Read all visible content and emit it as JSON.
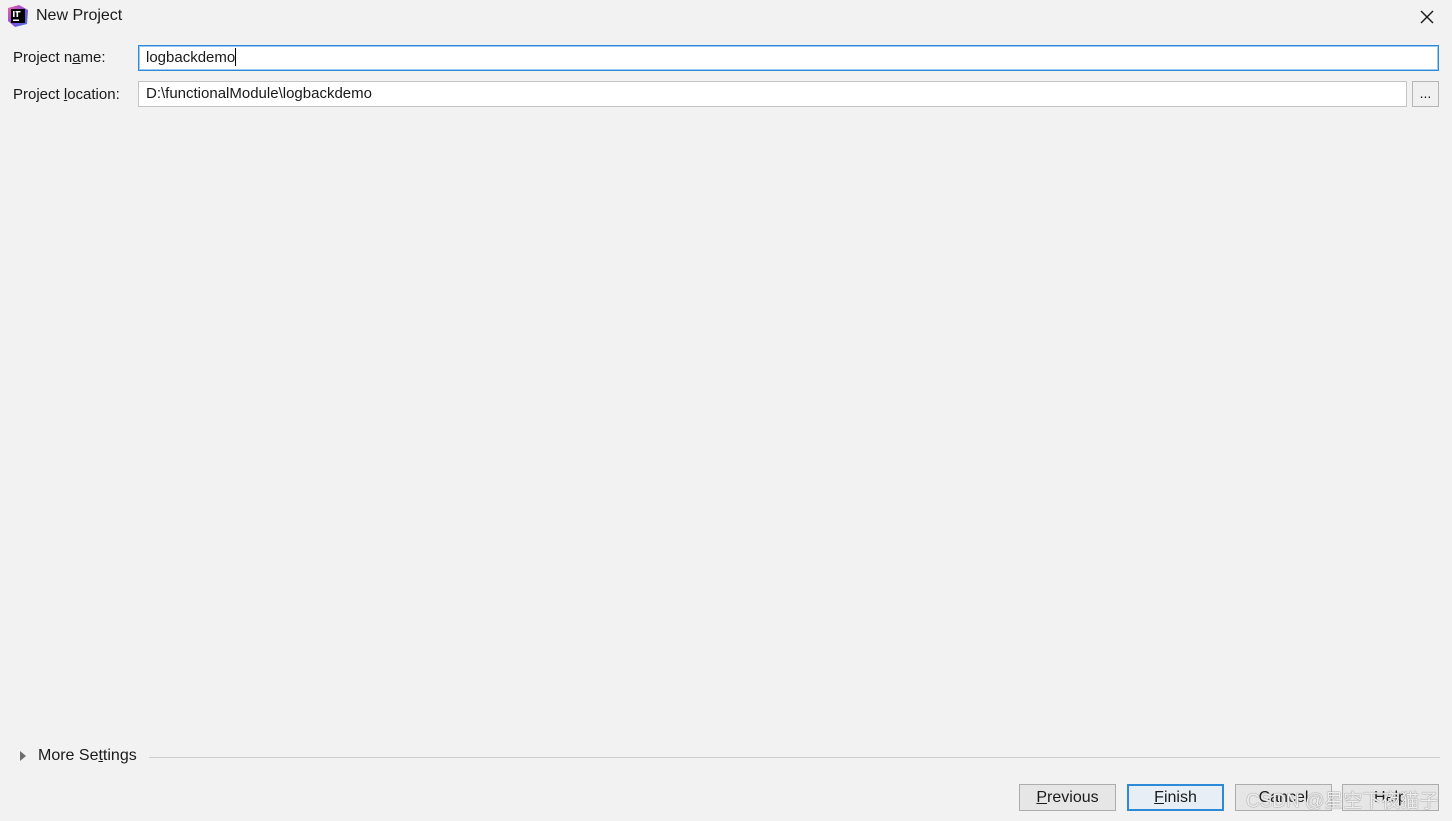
{
  "window": {
    "title": "New Project",
    "icon": "intellij-idea-icon",
    "close_icon": "close-icon"
  },
  "form": {
    "project_name": {
      "label_pre": "Project n",
      "label_mnemonic": "a",
      "label_post": "me:",
      "value": "logbackdemo"
    },
    "project_location": {
      "label_pre": "Project ",
      "label_mnemonic": "l",
      "label_post": "ocation:",
      "value": "D:\\functionalModule\\logbackdemo",
      "browse_label": "..."
    }
  },
  "more_settings": {
    "label_pre": "More Se",
    "label_mnemonic": "t",
    "label_post": "tings",
    "expanded": false
  },
  "buttons": {
    "previous": {
      "mnemonic": "P",
      "rest": "revious"
    },
    "finish": {
      "mnemonic": "F",
      "rest": "inish"
    },
    "cancel": {
      "label": "Cancel"
    },
    "help": {
      "label": "Help"
    }
  },
  "watermark": "CSDN @星空下夜猫子",
  "colors": {
    "background": "#f2f2f2",
    "focus_border": "#2d8ad9",
    "input_background": "#ffffff"
  }
}
